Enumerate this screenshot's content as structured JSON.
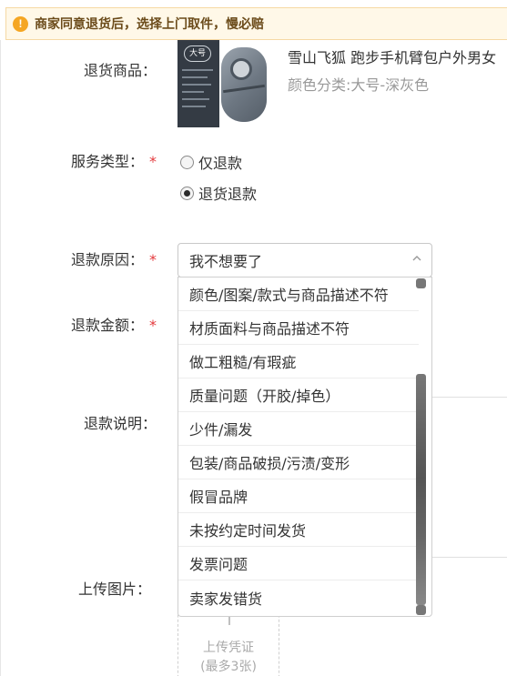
{
  "notice": {
    "icon": "warning-icon",
    "text": "商家同意退货后，选择上门取件，慢必赔"
  },
  "labels": {
    "product": "退货商品：",
    "service": "服务类型：",
    "reason": "退款原因：",
    "amount": "退款金额：",
    "desc": "退款说明：",
    "upload": "上传图片："
  },
  "required_mark": "*",
  "product": {
    "title": "雪山飞狐 跑步手机臂包户外男女",
    "spec": "颜色分类:大号-深灰色",
    "image_tag": "大号"
  },
  "service_options": [
    {
      "label": "仅退款",
      "selected": false
    },
    {
      "label": "退货退款",
      "selected": true
    }
  ],
  "reason_select": {
    "value": "我不想要了",
    "options": [
      "颜色/图案/款式与商品描述不符",
      "材质面料与商品描述不符",
      "做工粗糙/有瑕疵",
      "质量问题（开胶/掉色）",
      "少件/漏发",
      "包装/商品破损/污渍/变形",
      "假冒品牌",
      "未按约定时间发货",
      "发票问题",
      "卖家发错货"
    ]
  },
  "upload": {
    "line1": "上传凭证",
    "line2": "(最多3张)"
  }
}
